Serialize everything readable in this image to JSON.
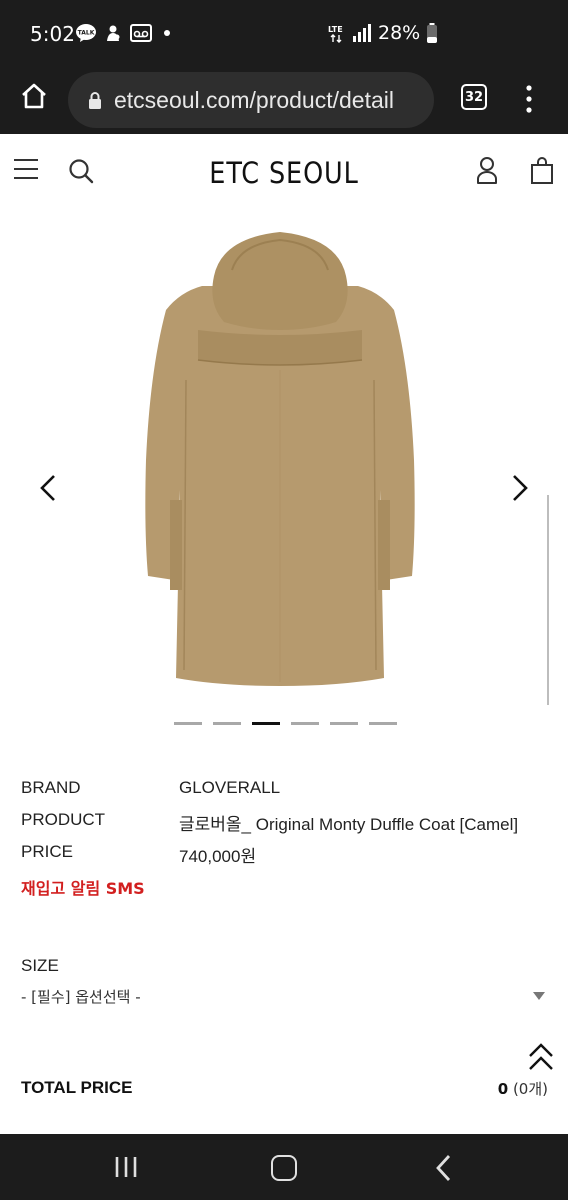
{
  "status_bar": {
    "time": "5:02",
    "left_icons": [
      "talk-icon",
      "snapchat-icon",
      "voicemail-icon"
    ],
    "network": "LTE",
    "battery": "28%"
  },
  "browser": {
    "url": "etcseoul.com/product/detail",
    "tab_count": "32"
  },
  "site": {
    "logo": "ETC SEOUL"
  },
  "gallery": {
    "image": "camel-duffle-coat",
    "image_count": 6,
    "active_index": 2
  },
  "product": {
    "rows": [
      {
        "label": "BRAND",
        "value": "GLOVERALL"
      },
      {
        "label": "PRODUCT",
        "value": "글로버올_ Original Monty Duffle Coat [Camel]"
      },
      {
        "label": "PRICE",
        "value": "740,000원"
      }
    ],
    "restock_alert": "재입고 알림 SMS"
  },
  "options": {
    "size_label": "SIZE",
    "size_selected": "- [필수] 옵션선택 -"
  },
  "total": {
    "label": "TOTAL PRICE",
    "amount": "0",
    "count": "(0개)"
  },
  "colors": {
    "restock_red": "#d21f1f",
    "coat_camel": "#b69a6e",
    "system_bar": "#1c1c1c"
  }
}
